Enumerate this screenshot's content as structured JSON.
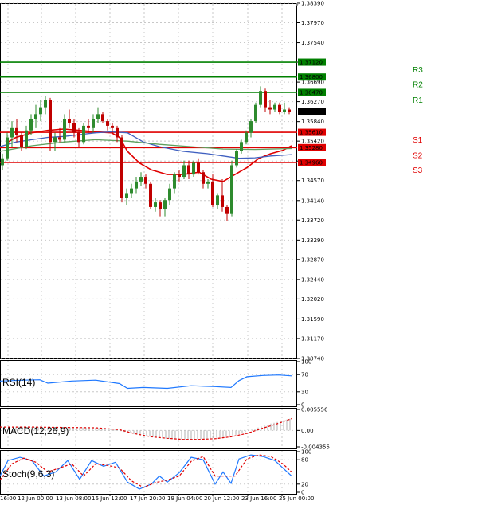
{
  "chart_data": {
    "type": "candlestick",
    "y_axis": {
      "ylim": [
        1.3074,
        1.3839
      ],
      "ticks": [
        "1.38390",
        "1.37970",
        "1.37540",
        "1.37120",
        "1.36690",
        "1.36270",
        "1.35840",
        "1.35420",
        "1.34990",
        "1.34570",
        "1.34140",
        "1.33720",
        "1.33290",
        "1.32870",
        "1.32440",
        "1.32020",
        "1.31590",
        "1.31170",
        "1.30740"
      ]
    },
    "x_axis": {
      "ticks": [
        "16:00",
        "12 Jun 00:00",
        "13 Jun 08:00",
        "16 Jun 12:00",
        "17 Jun 20:00",
        "19 Jun 04:00",
        "20 Jun 12:00",
        "23 Jun 16:00",
        "25 Jun 00:00"
      ]
    },
    "current_price": "1.36055",
    "levels": [
      {
        "name": "R3",
        "value": 1.3712,
        "label": "1.37120",
        "color": "#008000"
      },
      {
        "name": "R2",
        "value": 1.368,
        "label": "1.36800",
        "color": "#008000"
      },
      {
        "name": "R1",
        "value": 1.3647,
        "label": "1.36470",
        "color": "#008000"
      },
      {
        "name": "S1",
        "value": 1.3561,
        "label": "1.35610",
        "color": "#e00000"
      },
      {
        "name": "S2",
        "value": 1.3528,
        "label": "1.35280",
        "color": "#e00000"
      },
      {
        "name": "S3",
        "value": 1.3496,
        "label": "1.34960",
        "color": "#e00000"
      }
    ],
    "candles": [
      [
        1.349,
        1.3515,
        1.348,
        1.3505
      ],
      [
        1.3505,
        1.356,
        1.35,
        1.355
      ],
      [
        1.355,
        1.3585,
        1.353,
        1.357
      ],
      [
        1.357,
        1.359,
        1.354,
        1.3555
      ],
      [
        1.3555,
        1.356,
        1.352,
        1.353
      ],
      [
        1.353,
        1.3575,
        1.3525,
        1.3565
      ],
      [
        1.3565,
        1.36,
        1.3555,
        1.359
      ],
      [
        1.359,
        1.362,
        1.357,
        1.36
      ],
      [
        1.36,
        1.363,
        1.3585,
        1.3615
      ],
      [
        1.3615,
        1.364,
        1.36,
        1.363
      ],
      [
        1.363,
        1.3635,
        1.352,
        1.354
      ],
      [
        1.354,
        1.356,
        1.352,
        1.355
      ],
      [
        1.355,
        1.357,
        1.354,
        1.3545
      ],
      [
        1.3545,
        1.36,
        1.354,
        1.359
      ],
      [
        1.359,
        1.361,
        1.357,
        1.358
      ],
      [
        1.358,
        1.359,
        1.355,
        1.356
      ],
      [
        1.356,
        1.357,
        1.353,
        1.354
      ],
      [
        1.354,
        1.358,
        1.3535,
        1.3575
      ],
      [
        1.3575,
        1.359,
        1.356,
        1.357
      ],
      [
        1.357,
        1.36,
        1.356,
        1.359
      ],
      [
        1.359,
        1.3615,
        1.358,
        1.36
      ],
      [
        1.36,
        1.3605,
        1.358,
        1.3585
      ],
      [
        1.3585,
        1.359,
        1.3565,
        1.3575
      ],
      [
        1.3575,
        1.358,
        1.356,
        1.357
      ],
      [
        1.357,
        1.3575,
        1.354,
        1.355
      ],
      [
        1.355,
        1.3555,
        1.341,
        1.342
      ],
      [
        1.342,
        1.344,
        1.3405,
        1.343
      ],
      [
        1.343,
        1.345,
        1.342,
        1.344
      ],
      [
        1.344,
        1.3465,
        1.343,
        1.3455
      ],
      [
        1.3455,
        1.3475,
        1.3445,
        1.3465
      ],
      [
        1.3465,
        1.347,
        1.344,
        1.345
      ],
      [
        1.345,
        1.3455,
        1.3395,
        1.34
      ],
      [
        1.34,
        1.342,
        1.339,
        1.341
      ],
      [
        1.341,
        1.3415,
        1.338,
        1.3395
      ],
      [
        1.3395,
        1.342,
        1.338,
        1.3415
      ],
      [
        1.3415,
        1.345,
        1.3405,
        1.344
      ],
      [
        1.344,
        1.3475,
        1.343,
        1.347
      ],
      [
        1.347,
        1.348,
        1.3455,
        1.3465
      ],
      [
        1.3465,
        1.35,
        1.346,
        1.349
      ],
      [
        1.349,
        1.35,
        1.346,
        1.347
      ],
      [
        1.347,
        1.35,
        1.3465,
        1.3495
      ],
      [
        1.3495,
        1.3505,
        1.347,
        1.3475
      ],
      [
        1.3475,
        1.348,
        1.344,
        1.345
      ],
      [
        1.345,
        1.346,
        1.344,
        1.3455
      ],
      [
        1.3455,
        1.347,
        1.34,
        1.3405
      ],
      [
        1.3405,
        1.343,
        1.3395,
        1.3425
      ],
      [
        1.3425,
        1.346,
        1.339,
        1.34
      ],
      [
        1.34,
        1.3405,
        1.337,
        1.3385
      ],
      [
        1.3385,
        1.35,
        1.338,
        1.349
      ],
      [
        1.349,
        1.3525,
        1.3485,
        1.352
      ],
      [
        1.352,
        1.3545,
        1.3515,
        1.354
      ],
      [
        1.354,
        1.3565,
        1.3535,
        1.356
      ],
      [
        1.356,
        1.359,
        1.355,
        1.3585
      ],
      [
        1.3585,
        1.3625,
        1.358,
        1.362
      ],
      [
        1.362,
        1.366,
        1.3615,
        1.365
      ],
      [
        1.365,
        1.3655,
        1.3605,
        1.3615
      ],
      [
        1.3615,
        1.363,
        1.36,
        1.361
      ],
      [
        1.361,
        1.3625,
        1.3605,
        1.362
      ],
      [
        1.362,
        1.3625,
        1.36,
        1.3605
      ],
      [
        1.3605,
        1.3625,
        1.36,
        1.361
      ],
      [
        1.361,
        1.3615,
        1.36,
        1.3605
      ]
    ],
    "moving_averages": [
      {
        "color": "#e00000",
        "points": [
          [
            10,
            1.354
          ],
          [
            20,
            1.355
          ],
          [
            40,
            1.356
          ],
          [
            60,
            1.3565
          ],
          [
            80,
            1.3568
          ],
          [
            100,
            1.3565
          ],
          [
            120,
            1.3562
          ],
          [
            140,
            1.356
          ],
          [
            150,
            1.355
          ],
          [
            160,
            1.352
          ],
          [
            175,
            1.3495
          ],
          [
            190,
            1.348
          ],
          [
            210,
            1.347
          ],
          [
            230,
            1.347
          ],
          [
            250,
            1.3475
          ],
          [
            265,
            1.346
          ],
          [
            280,
            1.3455
          ],
          [
            295,
            1.347
          ],
          [
            310,
            1.3485
          ],
          [
            325,
            1.3505
          ],
          [
            340,
            1.3515
          ],
          [
            355,
            1.3522
          ],
          [
            366,
            1.3532
          ]
        ]
      },
      {
        "color": "#4060c0",
        "points": [
          [
            0,
            1.353
          ],
          [
            20,
            1.354
          ],
          [
            40,
            1.3545
          ],
          [
            60,
            1.355
          ],
          [
            80,
            1.3552
          ],
          [
            100,
            1.3556
          ],
          [
            120,
            1.356
          ],
          [
            140,
            1.3562
          ],
          [
            160,
            1.356
          ],
          [
            180,
            1.354
          ],
          [
            200,
            1.353
          ],
          [
            230,
            1.352
          ],
          [
            260,
            1.3515
          ],
          [
            280,
            1.351
          ],
          [
            300,
            1.3505
          ],
          [
            320,
            1.3506
          ],
          [
            340,
            1.351
          ],
          [
            366,
            1.3513
          ]
        ]
      },
      {
        "color": "#60a060",
        "points": [
          [
            0,
            1.352
          ],
          [
            40,
            1.3532
          ],
          [
            80,
            1.354
          ],
          [
            120,
            1.3545
          ],
          [
            160,
            1.3542
          ],
          [
            200,
            1.3535
          ],
          [
            240,
            1.353
          ],
          [
            280,
            1.3525
          ],
          [
            320,
            1.3524
          ],
          [
            366,
            1.3526
          ]
        ]
      }
    ],
    "indicators": [
      {
        "name": "RSI(14)",
        "range": [
          0,
          100
        ],
        "ticks": [
          "100",
          "70",
          "30",
          "0"
        ],
        "tick_values": [
          100,
          70,
          30,
          0
        ],
        "color": "#1e78ff",
        "points": [
          [
            0,
            55
          ],
          [
            30,
            57
          ],
          [
            50,
            58
          ],
          [
            60,
            50
          ],
          [
            90,
            55
          ],
          [
            120,
            57
          ],
          [
            150,
            49
          ],
          [
            160,
            38
          ],
          [
            180,
            40
          ],
          [
            210,
            38
          ],
          [
            240,
            44
          ],
          [
            270,
            42
          ],
          [
            290,
            40
          ],
          [
            300,
            56
          ],
          [
            310,
            65
          ],
          [
            330,
            68
          ],
          [
            350,
            69
          ],
          [
            366,
            67
          ]
        ]
      },
      {
        "name": "MACD(12,26,9)",
        "range": [
          -0.004355,
          0.005556
        ],
        "ticks": [
          "0.005556",
          "0.00",
          "-0.004355"
        ],
        "tick_values": [
          0.005556,
          0,
          -0.004355
        ],
        "color": "#e00000",
        "hist": [
          [
            20,
            0.001
          ],
          [
            40,
            0.0009
          ],
          [
            60,
            0.0008
          ],
          [
            80,
            0.0008
          ],
          [
            100,
            0.0008
          ],
          [
            120,
            0.0007
          ],
          [
            140,
            0.0004
          ],
          [
            160,
            -0.0006
          ],
          [
            180,
            -0.0014
          ],
          [
            200,
            -0.002
          ],
          [
            220,
            -0.0024
          ],
          [
            240,
            -0.0024
          ],
          [
            260,
            -0.0022
          ],
          [
            280,
            -0.0018
          ],
          [
            300,
            -0.001
          ],
          [
            320,
            0.0005
          ],
          [
            340,
            0.0018
          ],
          [
            366,
            0.0032
          ]
        ],
        "points": [
          [
            0,
            0.0009
          ],
          [
            40,
            0.0009
          ],
          [
            80,
            0.0008
          ],
          [
            120,
            0.0007
          ],
          [
            150,
            0.0002
          ],
          [
            170,
            -0.0009
          ],
          [
            190,
            -0.0017
          ],
          [
            210,
            -0.0021
          ],
          [
            230,
            -0.0024
          ],
          [
            250,
            -0.0024
          ],
          [
            270,
            -0.0022
          ],
          [
            290,
            -0.0017
          ],
          [
            310,
            -0.0008
          ],
          [
            330,
            0.0006
          ],
          [
            350,
            0.0019
          ],
          [
            366,
            0.0031
          ]
        ]
      },
      {
        "name": "Stoch(9,6,3)",
        "range": [
          0,
          100
        ],
        "ticks": [
          "100",
          "80",
          "20",
          "0"
        ],
        "tick_values": [
          100,
          80,
          20,
          0
        ],
        "color": "#1e78ff",
        "signal_color": "#e00000",
        "points": [
          [
            0,
            40
          ],
          [
            10,
            78
          ],
          [
            25,
            86
          ],
          [
            40,
            78
          ],
          [
            55,
            40
          ],
          [
            70,
            50
          ],
          [
            85,
            78
          ],
          [
            100,
            32
          ],
          [
            115,
            78
          ],
          [
            130,
            64
          ],
          [
            145,
            74
          ],
          [
            160,
            25
          ],
          [
            175,
            8
          ],
          [
            190,
            20
          ],
          [
            200,
            40
          ],
          [
            210,
            25
          ],
          [
            225,
            48
          ],
          [
            240,
            86
          ],
          [
            255,
            80
          ],
          [
            270,
            20
          ],
          [
            280,
            50
          ],
          [
            290,
            22
          ],
          [
            300,
            82
          ],
          [
            315,
            92
          ],
          [
            330,
            88
          ],
          [
            345,
            78
          ],
          [
            366,
            40
          ]
        ],
        "signal": [
          [
            0,
            30
          ],
          [
            15,
            70
          ],
          [
            30,
            84
          ],
          [
            45,
            74
          ],
          [
            60,
            50
          ],
          [
            75,
            60
          ],
          [
            90,
            70
          ],
          [
            105,
            40
          ],
          [
            120,
            70
          ],
          [
            135,
            66
          ],
          [
            150,
            60
          ],
          [
            165,
            28
          ],
          [
            180,
            12
          ],
          [
            195,
            24
          ],
          [
            210,
            30
          ],
          [
            225,
            40
          ],
          [
            240,
            76
          ],
          [
            255,
            88
          ],
          [
            270,
            40
          ],
          [
            282,
            40
          ],
          [
            295,
            40
          ],
          [
            310,
            82
          ],
          [
            325,
            92
          ],
          [
            340,
            88
          ],
          [
            355,
            70
          ],
          [
            366,
            50
          ]
        ]
      }
    ]
  }
}
